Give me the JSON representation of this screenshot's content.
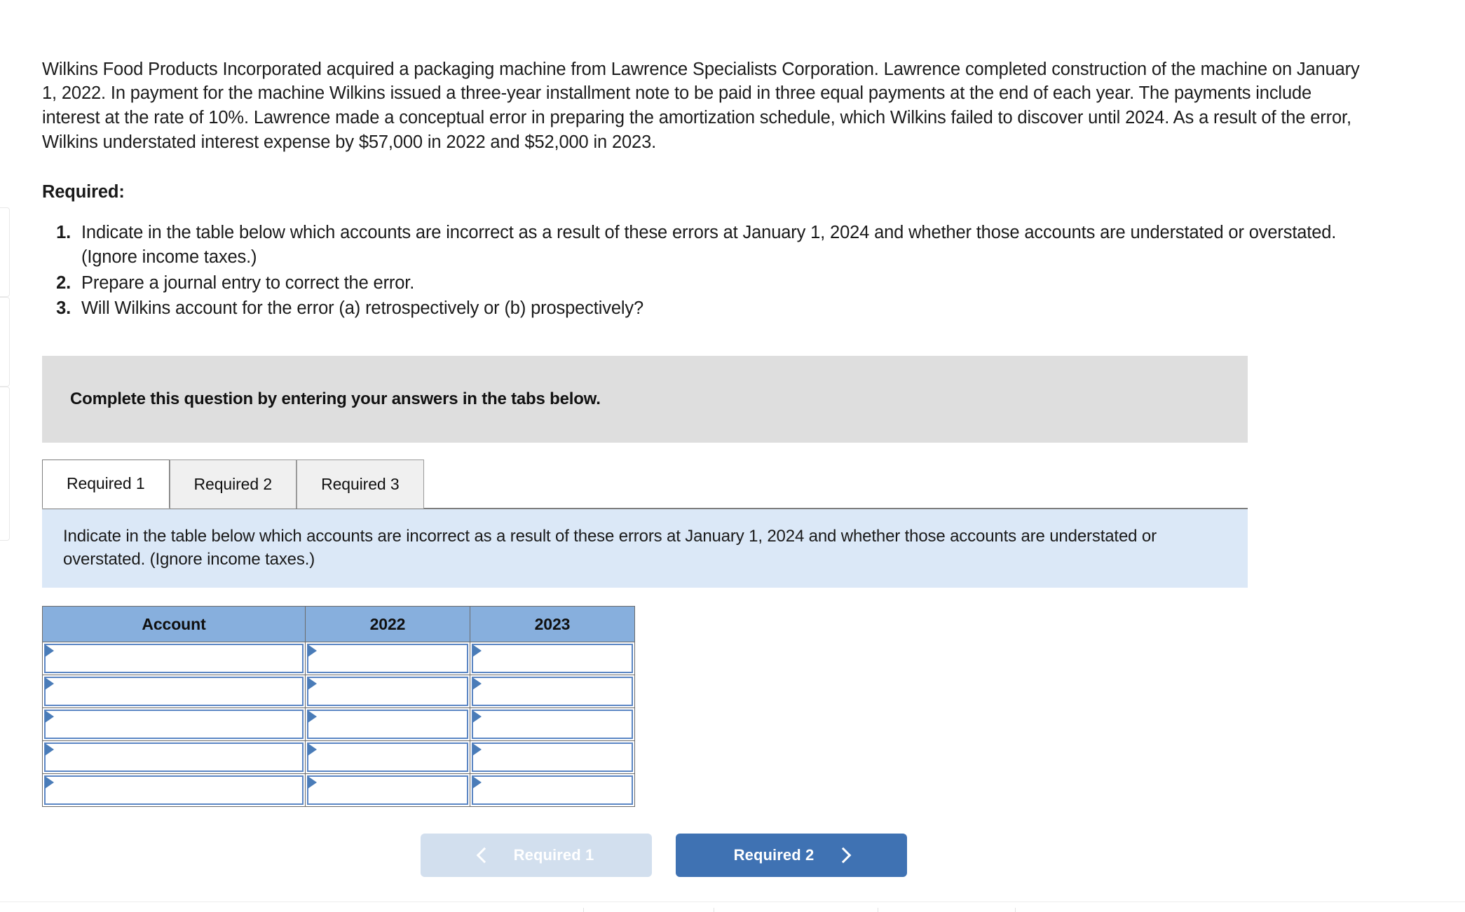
{
  "prompt": {
    "paragraph": "Wilkins Food Products Incorporated acquired a packaging machine from Lawrence Specialists Corporation. Lawrence completed construction of the machine on January 1, 2022. In payment for the machine Wilkins issued a three-year installment note to be paid in three equal payments at the end of each year. The payments include interest at the rate of 10%. Lawrence made a conceptual error in preparing the amortization schedule, which Wilkins failed to discover until 2024. As a result of the error, Wilkins understated interest expense by $57,000 in 2022 and $52,000 in 2023."
  },
  "required": {
    "heading": "Required:",
    "items": [
      "Indicate in the table below which accounts are incorrect as a result of these errors at January 1, 2024 and whether those accounts are understated or overstated. (Ignore income taxes.)",
      "Prepare a journal entry to correct the error.",
      "Will Wilkins account for the error (a) retrospectively or (b) prospectively?"
    ]
  },
  "gray_banner": {
    "text": "Complete this question by entering your answers in the tabs below."
  },
  "tabs": [
    {
      "label": "Required 1",
      "active": true
    },
    {
      "label": "Required 2",
      "active": false
    },
    {
      "label": "Required 3",
      "active": false
    }
  ],
  "blue_banner": {
    "text": "Indicate in the table below which accounts are incorrect as a result of these errors at January 1, 2024 and whether those accounts are understated or overstated. (Ignore income taxes.)"
  },
  "answer_table": {
    "headers": [
      "Account",
      "2022",
      "2023"
    ],
    "rows": [
      [
        "",
        "",
        ""
      ],
      [
        "",
        "",
        ""
      ],
      [
        "",
        "",
        ""
      ],
      [
        "",
        "",
        ""
      ],
      [
        "",
        "",
        ""
      ]
    ]
  },
  "navigation": {
    "prev_label": "Required 1",
    "next_label": "Required 2"
  },
  "colors": {
    "gray_banner_bg": "#dedede",
    "blue_banner_bg": "#dbe8f7",
    "table_header_bg": "#87afdd",
    "cell_border": "#5b86c4",
    "next_button_bg": "#3f72b3",
    "prev_button_bg": "#d2dfee"
  }
}
